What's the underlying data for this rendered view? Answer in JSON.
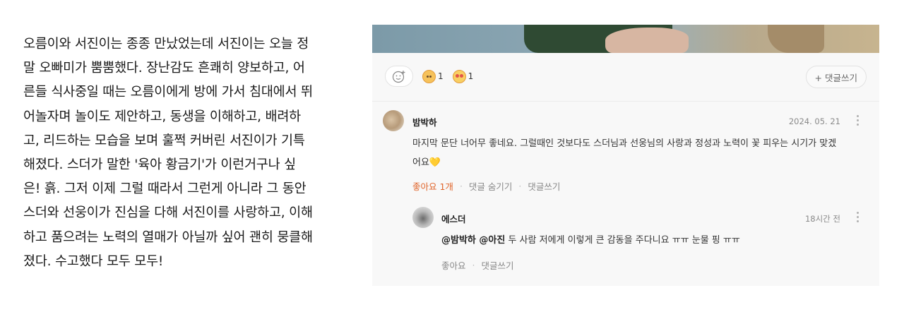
{
  "article": {
    "lines": [
      "오름이와 서진이는 종종 만났었는데 서진이는 오늘 정",
      "말 오빠미가 뿜뿜했다. 장난감도 흔쾌히 양보하고, 어",
      "른들 식사중일 때는 오름이에게 방에 가서 침대에서 뛰",
      "어놀자며 놀이도 제안하고, 동생을 이해하고, 배려하",
      "고, 리드하는 모습을 보며 훌쩍 커버린 서진이가 기특",
      "해졌다. 스더가 말한 '육아 황금기'가 이런거구나 싶",
      "은! 흙. 그저 이제 그럴 때라서 그런게 아니라 그 동안",
      "스더와 선웅이가 진심을 다해 서진이를 사랑하고, 이해",
      "하고 품으려는 노력의 열매가 아닐까 싶어 괜히 뭉클해",
      "졌다. 수고했다 모두 모두!"
    ]
  },
  "reactions": {
    "add_reaction_icon": "smiley-plus-icon",
    "items": [
      {
        "icon": "bear-face-icon",
        "count": "1"
      },
      {
        "icon": "heart-eyes-icon",
        "count": "1"
      }
    ],
    "add_comment_label": "+ 댓글쓰기"
  },
  "comments": [
    {
      "author": "밤박하",
      "date": "2024. 05. 21",
      "text_line1": "마지막 문단 너어무 좋네요. 그럴때인 것보다도 스더님과 선웅님의 사랑과 정성과 노력이 꽃 피우는 시기가 맞겠",
      "text_line2": "어요",
      "emoji": "💛",
      "like_label": "좋아요 1개",
      "hide_label": "댓글 숨기기",
      "reply_label": "댓글쓰기"
    },
    {
      "author": "에스더",
      "date": "18시간 전",
      "mention": "@밤박하 @아진",
      "text": " 두 사람 저에게 이렇게 큰 감동을 주다니요 ㅠㅠ 눈물 핑 ㅠㅠ",
      "like_label": "좋아요",
      "reply_label": "댓글쓰기"
    }
  ],
  "colors": {
    "accent_like": "#e0652b",
    "panel_bg": "#f8f8f8"
  }
}
